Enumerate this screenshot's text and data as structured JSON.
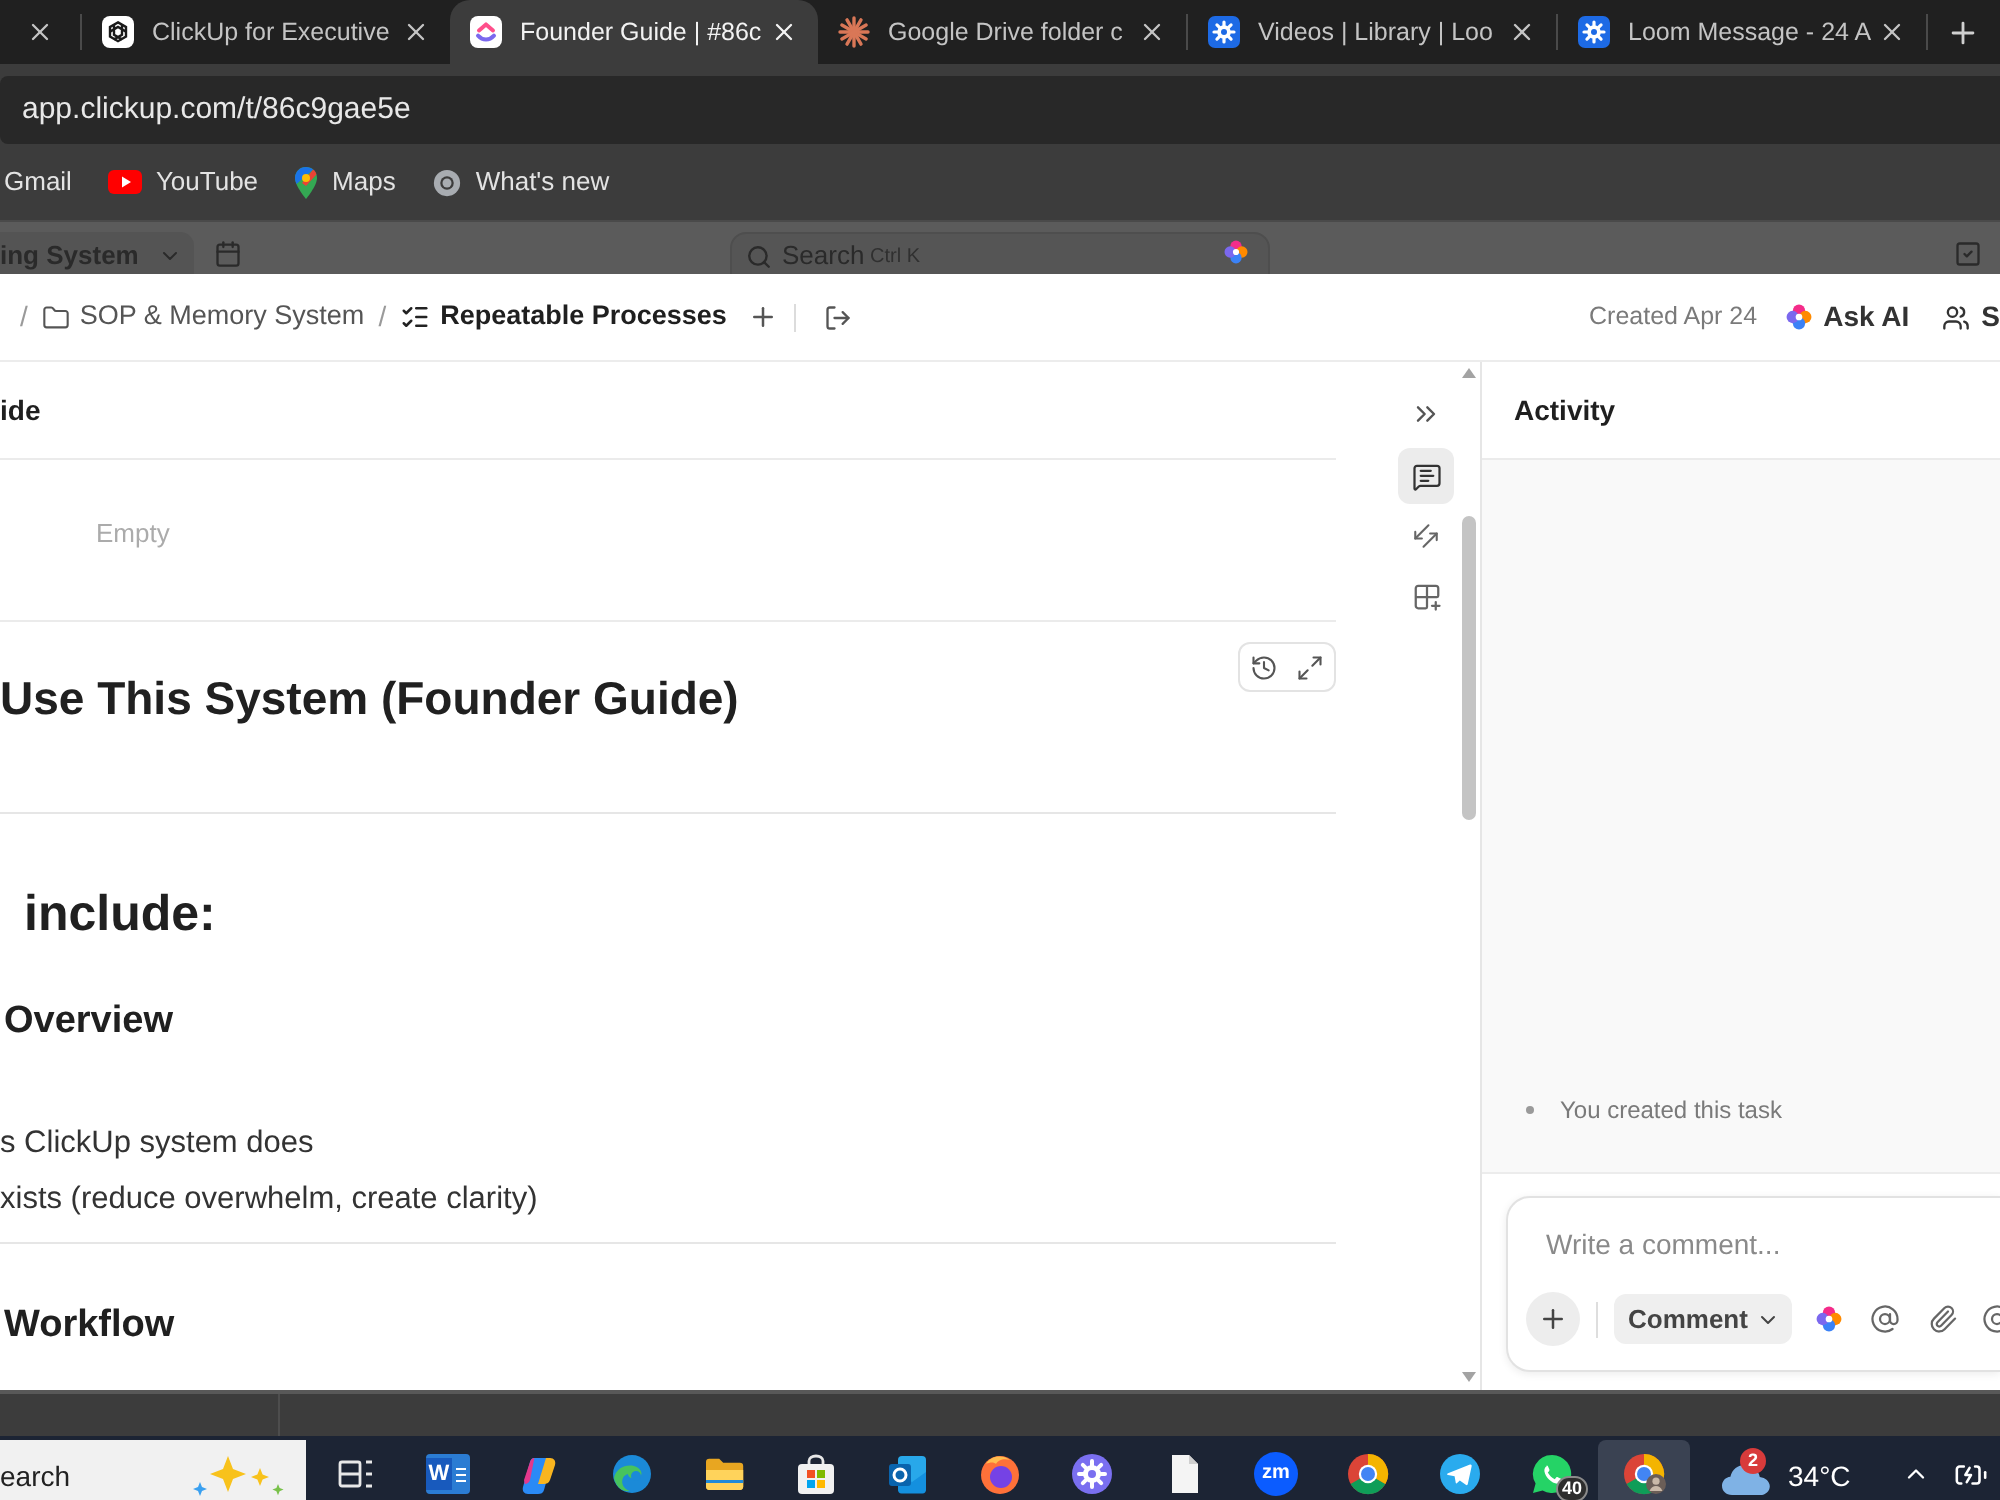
{
  "browser": {
    "tabs": [
      {
        "selected": false
      },
      {
        "title": "ClickUp for Executive",
        "kind": "knot",
        "selected": false
      },
      {
        "title": "Founder Guide | #86c",
        "kind": "chevron",
        "selected": true
      },
      {
        "title": "Google Drive folder c",
        "kind": "burst",
        "selected": false
      },
      {
        "title": "Videos | Library | Loo",
        "kind": "gear",
        "selected": false
      },
      {
        "title": "Loom Message - 24 A",
        "kind": "gear",
        "selected": false
      }
    ],
    "address": "app.clickup.com/t/86c9gae5e",
    "bookmarks": [
      {
        "label": "Gmail",
        "kind": "none"
      },
      {
        "label": "YouTube",
        "kind": "play"
      },
      {
        "label": "Maps",
        "kind": "pin"
      },
      {
        "label": "What's new",
        "kind": "ring"
      }
    ]
  },
  "app_header": {
    "workspace": "ing System",
    "search": {
      "placeholder": "Search",
      "shortcut": "Ctrl K"
    }
  },
  "task": {
    "separator": "/",
    "breadcrumbs": [
      {
        "label": "SOP & Memory System",
        "kind": "folder",
        "current": false
      },
      {
        "label": "Repeatable Processes",
        "kind": "list",
        "current": true
      }
    ],
    "created": "Created Apr 24",
    "ask_ai": "Ask AI",
    "share": "S",
    "title": "ide",
    "field_value": "Empty",
    "doc": [
      {
        "kind": "h1",
        "text": "Use This System (Founder Guide)"
      },
      {
        "kind": "divider"
      },
      {
        "kind": "h2",
        "text": "include:"
      },
      {
        "kind": "h3",
        "text": "Overview"
      },
      {
        "kind": "list",
        "items": [
          "s ClickUp system does",
          "xists (reduce overwhelm, create clarity)"
        ]
      },
      {
        "kind": "divider"
      },
      {
        "kind": "h3",
        "text": "Workflow"
      }
    ],
    "side_tools": [
      {
        "kind": "comments",
        "selected": true
      },
      {
        "kind": "arrows",
        "selected": false
      },
      {
        "kind": "apps",
        "selected": false
      }
    ]
  },
  "activity": {
    "title": "Activity",
    "entries": [
      "You created this task"
    ],
    "comment": {
      "placeholder": "Write a comment...",
      "mode": "Comment"
    }
  },
  "taskbar": {
    "search": {
      "placeholder": "earch"
    },
    "apps": [
      {
        "kind": "taskview",
        "selected": false
      },
      {
        "kind": "doc",
        "glyph": "W",
        "selected": false
      },
      {
        "kind": "swirl",
        "selected": false
      },
      {
        "kind": "wave",
        "selected": false
      },
      {
        "kind": "folder",
        "selected": false
      },
      {
        "kind": "store",
        "selected": false
      },
      {
        "kind": "mail",
        "selected": false
      },
      {
        "kind": "flame",
        "selected": false
      },
      {
        "kind": "gear",
        "selected": false
      },
      {
        "kind": "file",
        "selected": false
      },
      {
        "kind": "video",
        "glyph": "zm",
        "selected": false
      },
      {
        "kind": "orb",
        "selected": false
      },
      {
        "kind": "plane",
        "selected": false
      },
      {
        "kind": "phone",
        "badge": "40",
        "selected": false
      },
      {
        "kind": "profile",
        "selected": true
      }
    ],
    "weather": {
      "temp": "34°C",
      "badge": "2"
    }
  }
}
